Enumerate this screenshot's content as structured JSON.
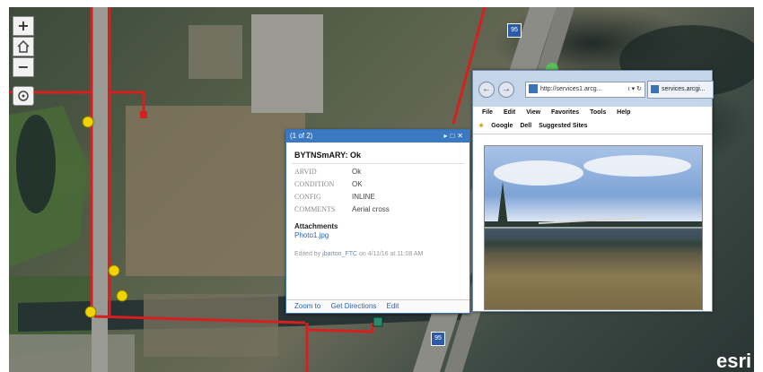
{
  "map": {
    "controls": {
      "zoom_in": "+",
      "zoom_out": "−",
      "home_icon": "home-icon",
      "locate_icon": "locate-icon"
    },
    "esri_logo": "esri",
    "highway_shields": [
      "95",
      "95"
    ]
  },
  "popup": {
    "counter": "(1 of 2)",
    "title": "BYTNSmARY: Ok",
    "fields": [
      {
        "key": "ARVID",
        "value": "Ok"
      },
      {
        "key": "CONDITION",
        "value": "OK"
      },
      {
        "key": "CONFIG",
        "value": "INLINE"
      },
      {
        "key": "COMMENTS",
        "value": "Aerial cross"
      }
    ],
    "attachments_label": "Attachments",
    "attachment_file": "Photo1.jpg",
    "edited_prefix": "Edited by",
    "edited_user": "jbarton_FTC",
    "edited_suffix": "on 4/11/16 at 11:08 AM",
    "footer": {
      "zoom": "Zoom to",
      "directions": "Get Directions",
      "edit": "Edit"
    }
  },
  "browser": {
    "url": "http://services1.arcg...",
    "url_controls": "⍳ ▾ ↻",
    "tab_title": "services.arcgi...",
    "menu": [
      "File",
      "Edit",
      "View",
      "Favorites",
      "Tools",
      "Help"
    ],
    "favorites": [
      "Google",
      "Dell",
      "Suggested Sites"
    ]
  },
  "colors": {
    "popup_header": "#3b79c3",
    "road": "#d62020",
    "point": "#f0d400"
  }
}
